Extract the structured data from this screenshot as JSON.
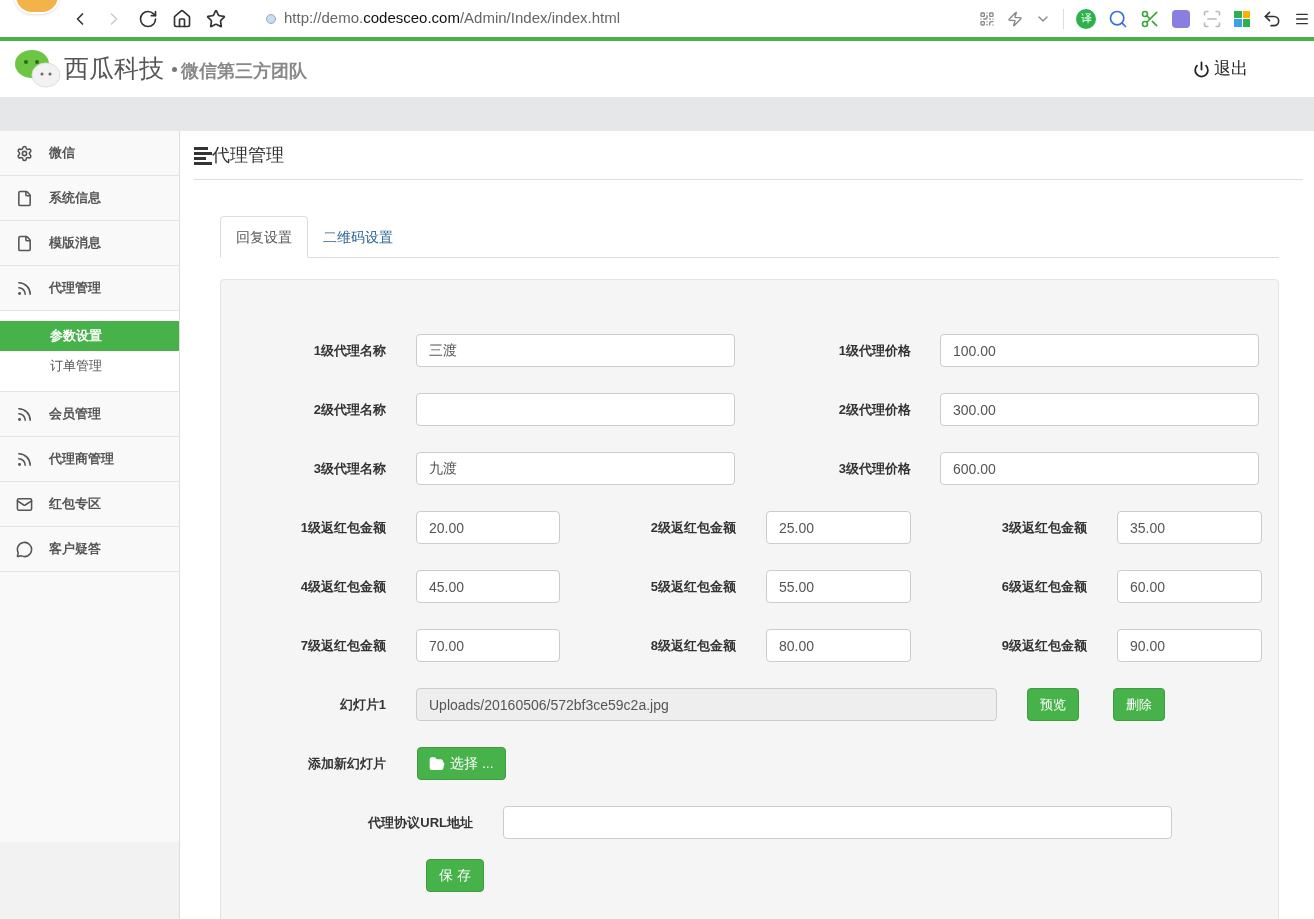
{
  "browser": {
    "url_host_pre": "http://demo.",
    "url_host": "codesceo.com",
    "url_path": "/Admin/Index/index.html",
    "translate_badge": "译"
  },
  "header": {
    "brand": "西瓜科技",
    "tagline": "微信第三方团队",
    "logout": "退出"
  },
  "sidebar": {
    "items": [
      {
        "label": "微信",
        "kind": "gear"
      },
      {
        "label": "系统信息",
        "kind": "doc"
      },
      {
        "label": "模版消息",
        "kind": "doc"
      },
      {
        "label": "代理管理",
        "kind": "feed",
        "children": [
          {
            "label": "参数设置",
            "selected": true
          },
          {
            "label": "订单管理",
            "selected": false
          }
        ]
      },
      {
        "label": "会员管理",
        "kind": "feed"
      },
      {
        "label": "代理商管理",
        "kind": "feed"
      },
      {
        "label": "红包专区",
        "kind": "mail"
      },
      {
        "label": "客户疑答",
        "kind": "chat"
      }
    ]
  },
  "page_title": "代理管理",
  "tabs": [
    {
      "label": "回复设置",
      "selected": true
    },
    {
      "label": "二维码设置",
      "selected": false
    }
  ],
  "agent_rows": [
    {
      "fields": [
        {
          "label": "1级代理名称",
          "value": "三渡"
        },
        {
          "label": "1级代理价格",
          "value": "100.00"
        }
      ]
    },
    {
      "fields": [
        {
          "label": "2级代理名称"
        },
        {
          "label": "2级代理价格",
          "value": "300.00"
        }
      ]
    },
    {
      "fields": [
        {
          "label": "3级代理名称",
          "value": "九渡"
        },
        {
          "label": "3级代理价格",
          "value": "600.00"
        }
      ]
    }
  ],
  "rebate_rows": [
    {
      "fields": [
        {
          "label": "1级返红包金额",
          "value": "20.00"
        },
        {
          "label": "2级返红包金额",
          "value": "25.00"
        },
        {
          "label": "3级返红包金额",
          "value": "35.00"
        }
      ]
    },
    {
      "fields": [
        {
          "label": "4级返红包金额",
          "value": "45.00"
        },
        {
          "label": "5级返红包金额",
          "value": "55.00"
        },
        {
          "label": "6级返红包金额",
          "value": "60.00"
        }
      ]
    },
    {
      "fields": [
        {
          "label": "7级返红包金额",
          "value": "70.00"
        },
        {
          "label": "8级返红包金额",
          "value": "80.00"
        },
        {
          "label": "9级返红包金额",
          "value": "90.00"
        }
      ]
    }
  ],
  "slide": {
    "label": "幻灯片1",
    "value": "Uploads/20160506/572bf3ce59c2a.jpg",
    "disabled": true,
    "buttons": [
      "预览",
      "删除"
    ]
  },
  "add_slide": {
    "label": "添加新幻灯片",
    "button": "选择 ..."
  },
  "url_field": {
    "label": "代理协议URL地址"
  },
  "save_button": "保 存"
}
